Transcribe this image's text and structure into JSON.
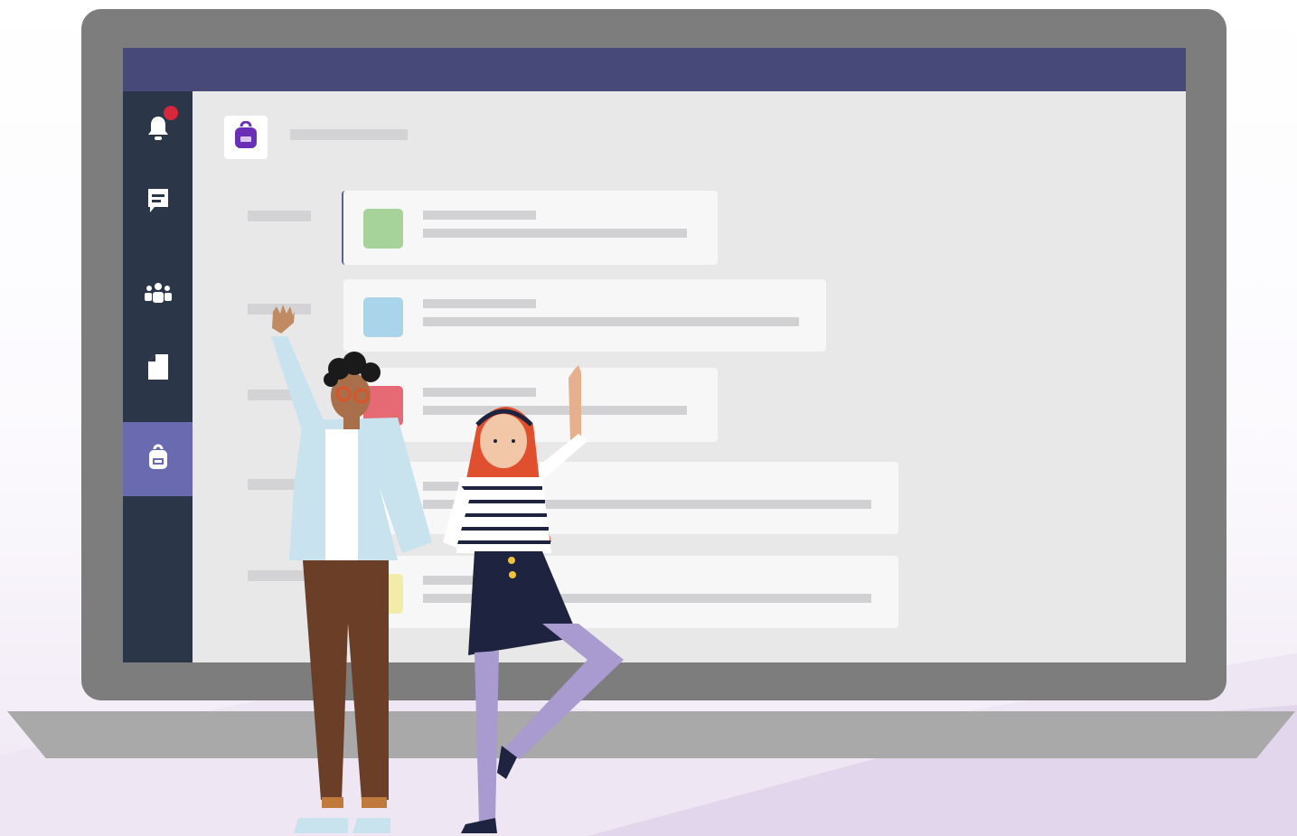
{
  "colors": {
    "titlebar": "#474a78",
    "rail": "#2c3649",
    "rail_active": "#6a6ab0",
    "notification": "#d6273b",
    "assignments_app": "#6b2fb5",
    "card_swatches": [
      "#a6d39a",
      "#a9d4ea",
      "#e66a73",
      "#ffffff",
      "#f2ecaa"
    ]
  },
  "rail": {
    "items": [
      {
        "icon": "bell-icon",
        "has_badge": true
      },
      {
        "icon": "chat-icon",
        "has_badge": false
      },
      {
        "icon": "teams-icon",
        "has_badge": false
      },
      {
        "icon": "files-icon",
        "has_badge": false
      },
      {
        "icon": "backpack-icon",
        "has_badge": false,
        "active": true
      }
    ]
  },
  "header": {
    "app_icon": "backpack-icon"
  },
  "cards": [
    {
      "swatch": "#a6d39a",
      "selected": true
    },
    {
      "swatch": "#a9d4ea",
      "selected": false
    },
    {
      "swatch": "#e66a73",
      "selected": false
    },
    {
      "swatch": "#ffffff",
      "selected": false
    },
    {
      "swatch": "#f2ecaa",
      "selected": false
    }
  ],
  "illustration": {
    "figures": [
      "waving-man",
      "waving-woman"
    ]
  }
}
